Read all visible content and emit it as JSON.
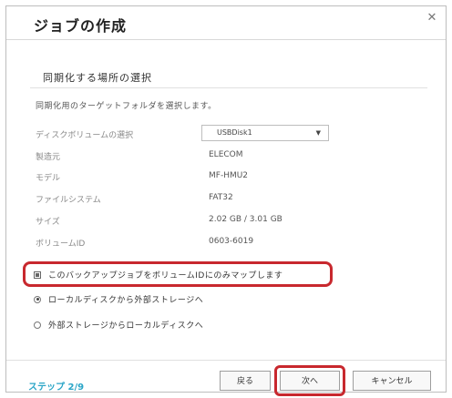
{
  "dialog": {
    "title": "ジョブの作成",
    "close_icon": "close-icon"
  },
  "section_title": "同期化する場所の選択",
  "description": "同期化用のターゲットフォルダを選択します。",
  "fields": {
    "disk_volume_label": "ディスクボリュームの選択",
    "disk_volume_value": "USBDisk1",
    "manufacturer_label": "製造元",
    "manufacturer_value": "ELECOM",
    "model_label": "モデル",
    "model_value": "MF-HMU2",
    "filesystem_label": "ファイルシステム",
    "filesystem_value": "FAT32",
    "size_label": "サイズ",
    "size_value": "2.02 GB / 3.01 GB",
    "volume_id_label": "ボリュームID",
    "volume_id_value": "0603-6019"
  },
  "options": {
    "checkbox_label": "このバックアップジョブをボリュームIDにのみマップします",
    "radio1_label": "ローカルディスクから外部ストレージへ",
    "radio2_label": "外部ストレージからローカルディスクへ"
  },
  "footer": {
    "step": "ステップ 2/9",
    "back_label": "戻る",
    "next_label": "次へ",
    "cancel_label": "キャンセル"
  },
  "colors": {
    "highlight": "#c8282e",
    "step_text": "#2aa5c7"
  }
}
